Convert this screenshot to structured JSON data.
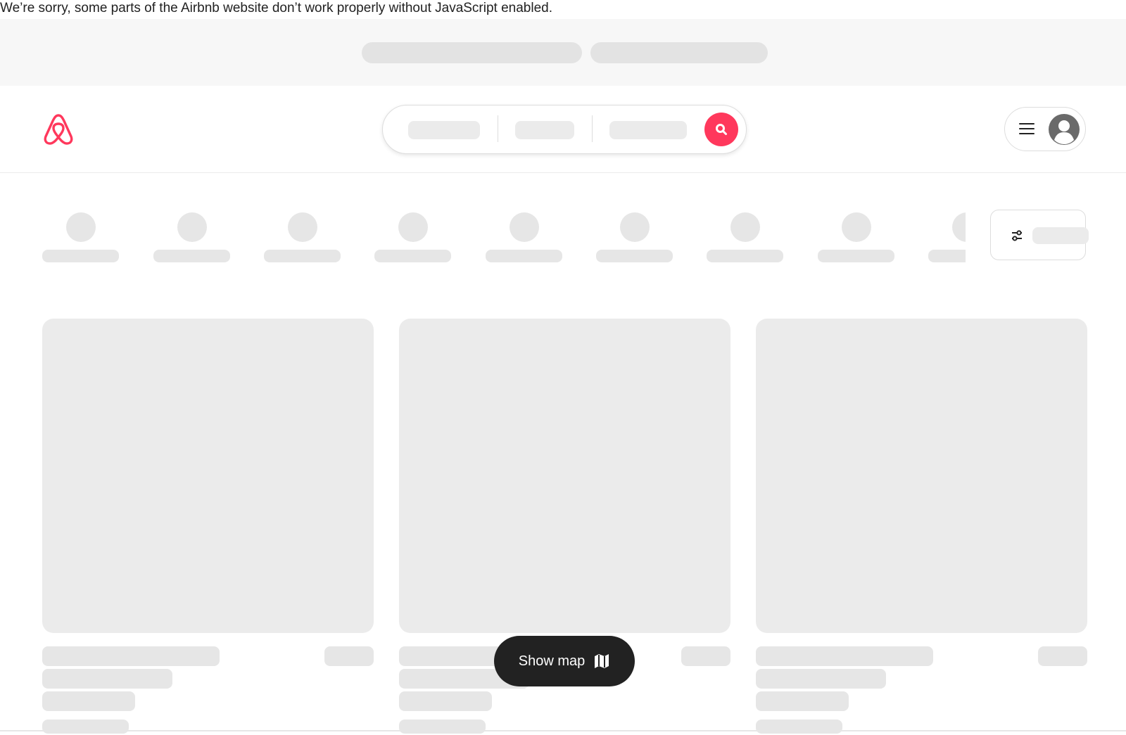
{
  "notice": {
    "text": "We’re sorry, some parts of the Airbnb website don’t work properly without JavaScript enabled."
  },
  "header": {
    "logo_icon": "airbnb-logo-icon",
    "search_icon": "search-icon",
    "menu_icon": "hamburger-menu-icon",
    "avatar_icon": "user-avatar-icon"
  },
  "filters": {
    "icon": "filters-sliders-icon"
  },
  "map_button": {
    "label": "Show map",
    "icon": "map-icon"
  },
  "colors": {
    "brand": "#ff385c",
    "dark": "#222222",
    "skeleton": "#e6e6e6",
    "banner_bg": "#f7f7f7"
  }
}
